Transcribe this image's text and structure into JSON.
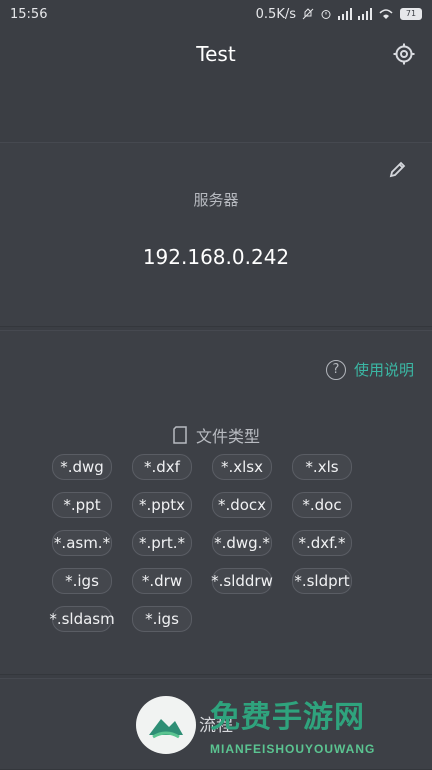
{
  "status": {
    "time": "15:56",
    "speed": "0.5K/s",
    "battery": "71"
  },
  "header": {
    "title": "Test"
  },
  "server": {
    "label": "服务器",
    "value": "192.168.0.242"
  },
  "help": {
    "label": "使用说明"
  },
  "file_types": {
    "title": "文件类型",
    "items": [
      "*.dwg",
      "*.dxf",
      "*.xlsx",
      "*.xls",
      "*.ppt",
      "*.pptx",
      "*.docx",
      "*.doc",
      "*.asm.*",
      "*.prt.*",
      "*.dwg.*",
      "*.dxf.*",
      "*.igs",
      "*.drw",
      "*.slddrw",
      "*.sldprt",
      "*.sldasm",
      "*.igs"
    ]
  },
  "bottom": {
    "label": "流程"
  },
  "watermark": {
    "text": "免费手游网",
    "sub": "MIANFEISHOUYOUWANG"
  },
  "colors": {
    "background": "#3b3e44",
    "accent": "#3bb7a4"
  },
  "icons": {
    "settings": "gear-icon",
    "edit": "pencil-icon",
    "help": "question-circle-icon",
    "file": "file-icon"
  }
}
